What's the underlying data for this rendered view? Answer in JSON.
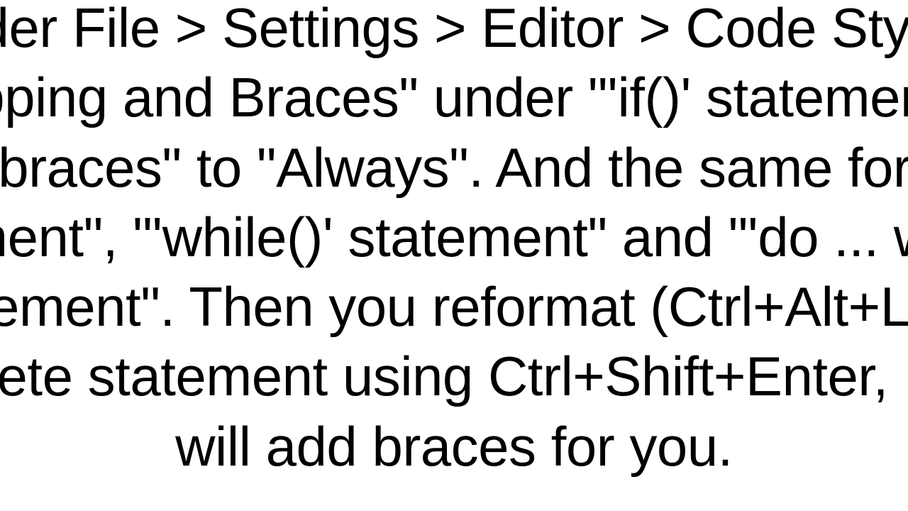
{
  "paragraph": {
    "text": "Under File > Settings > Editor > Code Style > \"Wrapping and Braces\" under \"'if()' statement\" set \"force braces\" to \"Always\". And the same for \"'for()' statement\", \"'while()' statement\" and \"'do ... while()' statement\". Then you reformat (Ctrl+Alt+L), or complete statement using Ctrl+Shift+Enter, IntelliJ will add braces for you."
  }
}
